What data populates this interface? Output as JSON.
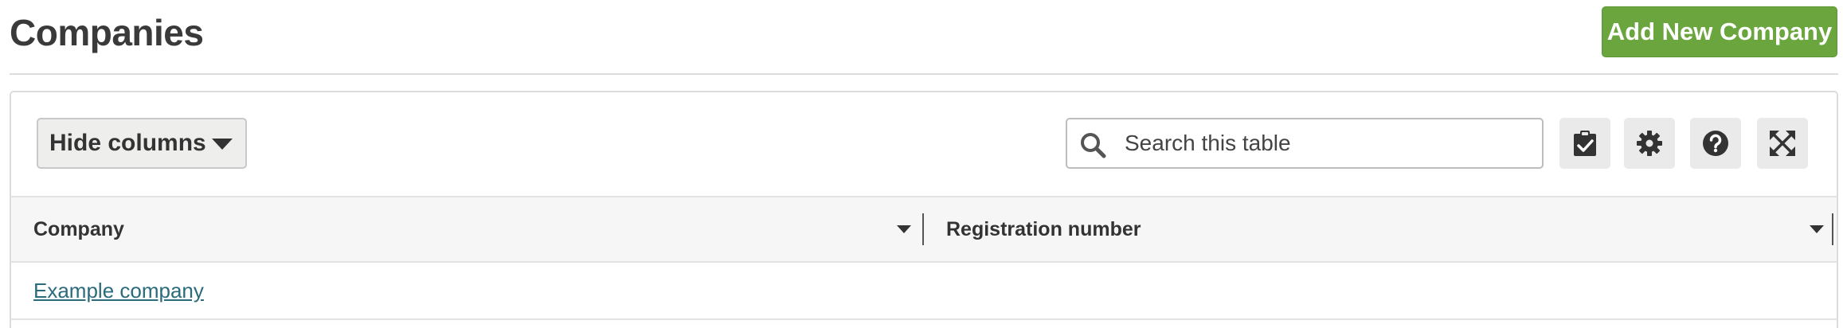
{
  "page": {
    "title": "Companies",
    "add_button_label": "Add New Company"
  },
  "toolbar": {
    "hide_columns_label": "Hide columns",
    "search_placeholder": "Search this table",
    "icons": [
      "search-icon",
      "clipboard-check-icon",
      "gear-icon",
      "question-icon",
      "expand-icon"
    ]
  },
  "table": {
    "columns": [
      {
        "label": "Company"
      },
      {
        "label": "Registration number"
      }
    ],
    "rows": [
      {
        "company": "Example company",
        "registration_number": ""
      }
    ]
  },
  "colors": {
    "accent_green": "#6aa63d",
    "link": "#2a6b7c",
    "header_bg": "#f6f6f6"
  }
}
